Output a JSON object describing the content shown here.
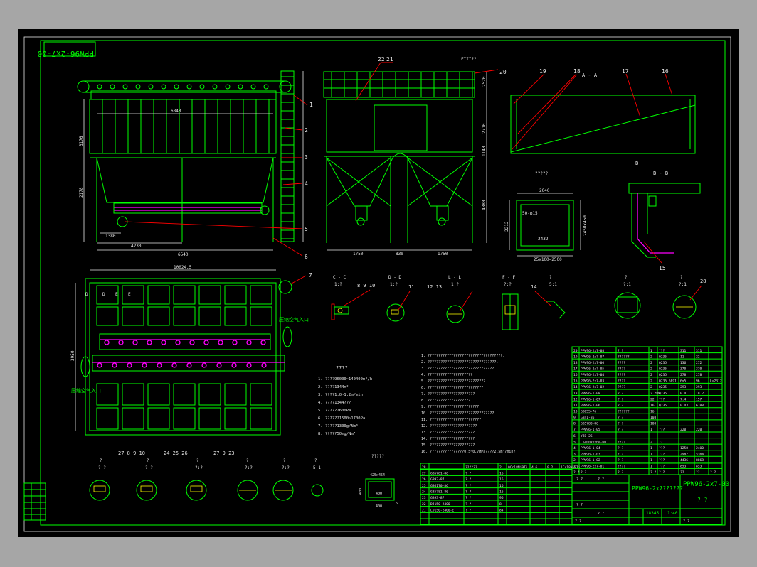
{
  "drawing": {
    "code_rotated": "PPW96-2x7-00",
    "code_titleblock": "PPW96-2x7-00",
    "title_mid": "PPW96-2x7??????",
    "weight": "18345",
    "scale": "1:40",
    "sheet_label": "? ?"
  },
  "colors": {
    "background": "#a6a6a6",
    "sheet": "#000000",
    "line": "#00ff00",
    "dimension": "#e6e6e6",
    "leader": "#ff0000",
    "screw": "#ff00ff"
  },
  "front_view": {
    "dims": {
      "total": "6540",
      "bay": "4230",
      "left": "1380",
      "h_upper": "3176",
      "h_lower": "2178",
      "inner": "6843"
    },
    "balloons": [
      "1",
      "2",
      "3",
      "4",
      "5",
      "6"
    ]
  },
  "side_view": {
    "dims": {
      "top_left": "FIII??",
      "top_right": "2520",
      "h_box": "2710",
      "h_mid": "1140",
      "h_hopper": "4880",
      "w_left": "1750",
      "w_mid": "830",
      "w_right": "1750"
    },
    "balloons_top": [
      "22",
      "21"
    ]
  },
  "plan_view": {
    "dims": {
      "overall": "10024.5",
      "height": "3950"
    },
    "labels": {
      "inlet_right": "压缩空气入口",
      "inlet_left": "压缩空气入口"
    },
    "section_marks": [
      "D",
      "D",
      "E",
      "E"
    ],
    "balloon": "7"
  },
  "section_aa": {
    "title": "A - A",
    "balloons": [
      "20",
      "19",
      "18",
      "17",
      "16"
    ],
    "mark": "B"
  },
  "view_box": {
    "title": "?????",
    "dims": {
      "w": "2040",
      "inner": "2432",
      "label": "50-ф15",
      "left": "2212",
      "right": "2450x450",
      "bottom": "25x100=2500"
    }
  },
  "section_bb": {
    "title": "B - B",
    "balloon": "15"
  },
  "details_row1": [
    {
      "title": "C - C",
      "scale": "1:?",
      "balloons": "8 9 10"
    },
    {
      "title": "D - D",
      "scale": "1:?",
      "balloons": "11"
    },
    {
      "title": "L - L",
      "scale": "1:?",
      "balloons": "12 13"
    },
    {
      "title": "F - F",
      "scale": "?:?",
      "balloons": ""
    },
    {
      "title": "?",
      "scale": "5:1",
      "balloons": "14"
    },
    {
      "title": "?",
      "scale": "?:1",
      "balloons": ""
    },
    {
      "title": "?",
      "scale": "?:1",
      "balloons": "28"
    }
  ],
  "details_row2": [
    {
      "title": "?",
      "scale": "?:?",
      "balloons": "27 8 9 10"
    },
    {
      "title": "?",
      "scale": "?:?",
      "balloons": "24 25 26"
    },
    {
      "title": "?",
      "scale": "?:?",
      "balloons": "27 9 23"
    },
    {
      "title": "?",
      "scale": "?:?",
      "balloons": ""
    },
    {
      "title": "?",
      "scale": "?:?",
      "balloons": ""
    },
    {
      "title": "?",
      "scale": "5:1",
      "balloons": ""
    }
  ],
  "tech_specs": {
    "title": "????",
    "items": [
      "1. ????96000~140400m³/h",
      "2. ????1344m²",
      "3. ????1.0~1.2m/min",
      "4. ????1344???",
      "5. ??????600Pa",
      "6. ??????1500~1700Pa",
      "7. ?????1300g/Nm³",
      "8. ?????50mg/Nm³"
    ]
  },
  "notes": {
    "items": [
      "1. ???????????????????????????????????.",
      "2. ????????????????????????????????.",
      "3. ???????????????????????????????",
      "4. ?????????????????????",
      "5. ???????????????????????????",
      "6. ??????????????????????????",
      "7. ??????????????????????",
      "8. ????????????????????",
      "9. ????????????????????????",
      "10. ??????????????????????????????",
      "11. ????????????????????????",
      "12. ??????????????????????",
      "13. ?????????????????????",
      "14. ?????????????????????",
      "15. ?????????????????????",
      "16. ????????????????0.5~0.7MPa????2.5m³/min?"
    ]
  },
  "duct_detail": {
    "title": "?????",
    "w": "425x454",
    "d1": "400",
    "d2": "400",
    "d3": "400",
    "t": "6"
  },
  "bom": [
    [
      "20",
      "PPW96-2x7-08",
      "? ?",
      "1",
      "???",
      "311",
      "311",
      ""
    ],
    [
      "19",
      "PPW96-2x7-07",
      "??????",
      "2",
      "Q235",
      "11",
      "22",
      ""
    ],
    [
      "18",
      "PPW96-2x7-06",
      "????",
      "2",
      "Q235",
      "136",
      "272",
      ""
    ],
    [
      "17",
      "PPW96-2x7-05",
      "????",
      "2",
      "Q235",
      "370",
      "370",
      ""
    ],
    [
      "16",
      "PPW96-2x7-04",
      "????",
      "2",
      "Q235",
      "278",
      "278",
      ""
    ],
    [
      "15",
      "PPW96-2x7-03",
      "????",
      "2",
      "Q235 6891",
      "6x5",
      "96",
      "L=2312"
    ],
    [
      "14",
      "PPW96-2x7-02",
      "????",
      "2",
      "Q235",
      "293",
      "293",
      ""
    ],
    [
      "13",
      "PPW96-1-08",
      "?  ?",
      "2 ?89",
      "Q235",
      "0.4",
      "19.2",
      ""
    ],
    [
      "12",
      "PPW96-1-07",
      "? ?",
      "22",
      "???",
      "7.4",
      "157",
      ""
    ],
    [
      "11",
      "PPW96-1-06",
      "? ?",
      "16",
      "Q235",
      "0.43",
      "6.88",
      ""
    ],
    [
      "10",
      "GB855-76",
      "??????",
      "16",
      "",
      "",
      "",
      ""
    ],
    [
      "9",
      "GB41-86",
      "? ?",
      "108",
      "",
      "",
      "",
      ""
    ],
    [
      "8",
      "GB5780-86",
      "? ?",
      "108",
      "",
      "",
      "",
      ""
    ],
    [
      "7",
      "PPW96-1-05",
      "? ?",
      "1",
      "???",
      "220",
      "220",
      ""
    ],
    [
      "6",
      "YJD-26",
      "",
      "",
      "",
      "",
      "",
      ""
    ],
    [
      "5",
      "LS400x6x6A-60",
      "????",
      "2",
      "??",
      "",
      "",
      ""
    ],
    [
      "4",
      "PPW96-1-04",
      "? ?",
      "1",
      "???",
      "1258",
      "2400",
      ""
    ],
    [
      "3",
      "PPW96-1-03",
      "? ?",
      "1",
      "???",
      "2982",
      "5364",
      ""
    ],
    [
      "2",
      "PPW96-1-02",
      "? ?",
      "1",
      "???",
      "4436",
      "8868",
      ""
    ],
    [
      "1",
      "PPW96-2x7-01",
      "????",
      "1",
      "???",
      "853",
      "853",
      ""
    ]
  ],
  "bom_header": [
    "? ?",
    "? ?",
    "? ?",
    "? ?",
    "? ?",
    "??",
    "??",
    "? ?"
  ],
  "bom2": [
    [
      "28",
      "",
      "??????",
      "2",
      "0Cr18Ni9Ti",
      "4.6",
      "9.2",
      "1Cr18Ni9Ti"
    ],
    [
      "27",
      "GB5781-86",
      "? ?",
      "16",
      "",
      "",
      "",
      ""
    ],
    [
      "26",
      "GB93-87",
      "? ?",
      "16",
      "",
      "",
      "",
      ""
    ],
    [
      "25",
      "GB6170-86",
      "? ?",
      "16",
      "",
      "",
      "",
      ""
    ],
    [
      "24",
      "GB5781-86",
      "? ?",
      "16",
      "",
      "",
      "",
      ""
    ],
    [
      "23",
      "GB93-87",
      "? ?",
      "96",
      "",
      "",
      "",
      ""
    ],
    [
      "22",
      "DJ150-2400",
      "? ?",
      "8",
      "",
      "",
      "",
      ""
    ],
    [
      "21",
      "LD150-2400-E",
      "? ?",
      "84",
      "",
      "",
      "",
      ""
    ]
  ],
  "revision_cells": [
    "? ?",
    "? ?",
    "? ?",
    "? ?",
    "? ?",
    "? ?"
  ]
}
